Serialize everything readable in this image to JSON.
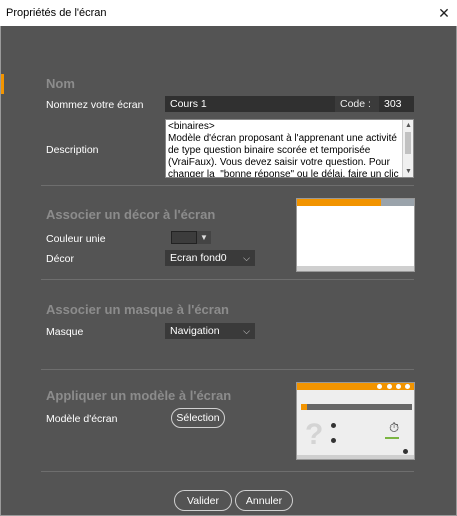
{
  "window": {
    "title": "Propriétés de l'écran",
    "close_glyph": "✕"
  },
  "nom": {
    "title": "Nom",
    "name_label": "Nommez votre écran",
    "name_value": "Cours 1",
    "code_label": "Code :",
    "code_value": "303",
    "description_label": "Description",
    "description_text": "<binaires>\nModèle d'écran proposant à l'apprenant une activité de type question binaire scorée et temporisée (VraiFaux). Vous devez saisir votre question. Pour changer la  \"bonne réponse\" ou le délai, faire un clic droit sur l'objet"
  },
  "decor": {
    "title": "Associer un décor à l'écran",
    "color_label": "Couleur unie",
    "color_value": "#3c3c3c",
    "decor_label": "Décor",
    "decor_value": "Ecran fond0"
  },
  "masque": {
    "title": "Associer un masque à l'écran",
    "masque_label": "Masque",
    "masque_value": "Navigation"
  },
  "modele": {
    "title": "Appliquer un modèle à l'écran",
    "modele_label": "Modèle d'écran",
    "selection_button": "Sélection"
  },
  "footer": {
    "validate_button": "Valider",
    "cancel_button": "Annuler"
  },
  "colors": {
    "accent": "#f29400",
    "dialog_bg": "#545454",
    "section_title": "#8c8c8c"
  },
  "icons": {
    "close": "close-icon",
    "dropdown": "chevron-down-icon"
  }
}
